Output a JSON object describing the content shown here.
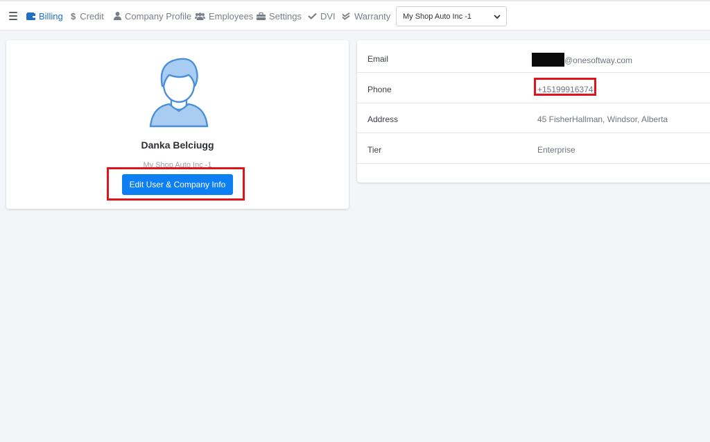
{
  "nav": {
    "items": [
      {
        "label": "Billing",
        "icon": "wallet-icon",
        "active": true
      },
      {
        "label": "Credit",
        "icon": "dollar-icon",
        "active": false
      },
      {
        "label": "Company Profile",
        "icon": "user-icon",
        "active": false
      },
      {
        "label": "Employees",
        "icon": "users-icon",
        "active": false
      },
      {
        "label": "Settings",
        "icon": "toolbox-icon",
        "active": false
      },
      {
        "label": "DVI",
        "icon": "check-icon",
        "active": false
      },
      {
        "label": "Warranty",
        "icon": "double-check-icon",
        "active": false
      }
    ],
    "shop_select": {
      "value": "My Shop Auto Inc -1"
    }
  },
  "profile": {
    "name": "Danka Belciugg",
    "company": "My Shop Auto Inc -1",
    "edit_button": "Edit User & Company Info"
  },
  "details": {
    "rows": [
      {
        "label": "Email",
        "value": "@onesoftway.com"
      },
      {
        "label": "Phone",
        "value": "+15199916374"
      },
      {
        "label": "Address",
        "value": "45 FisherHallman, Windsor, Alberta"
      },
      {
        "label": "Tier",
        "value": "Enterprise"
      }
    ]
  },
  "colors": {
    "accent": "#0d7ff2",
    "active_nav": "#1f6fc5",
    "highlight": "#e0141b"
  }
}
